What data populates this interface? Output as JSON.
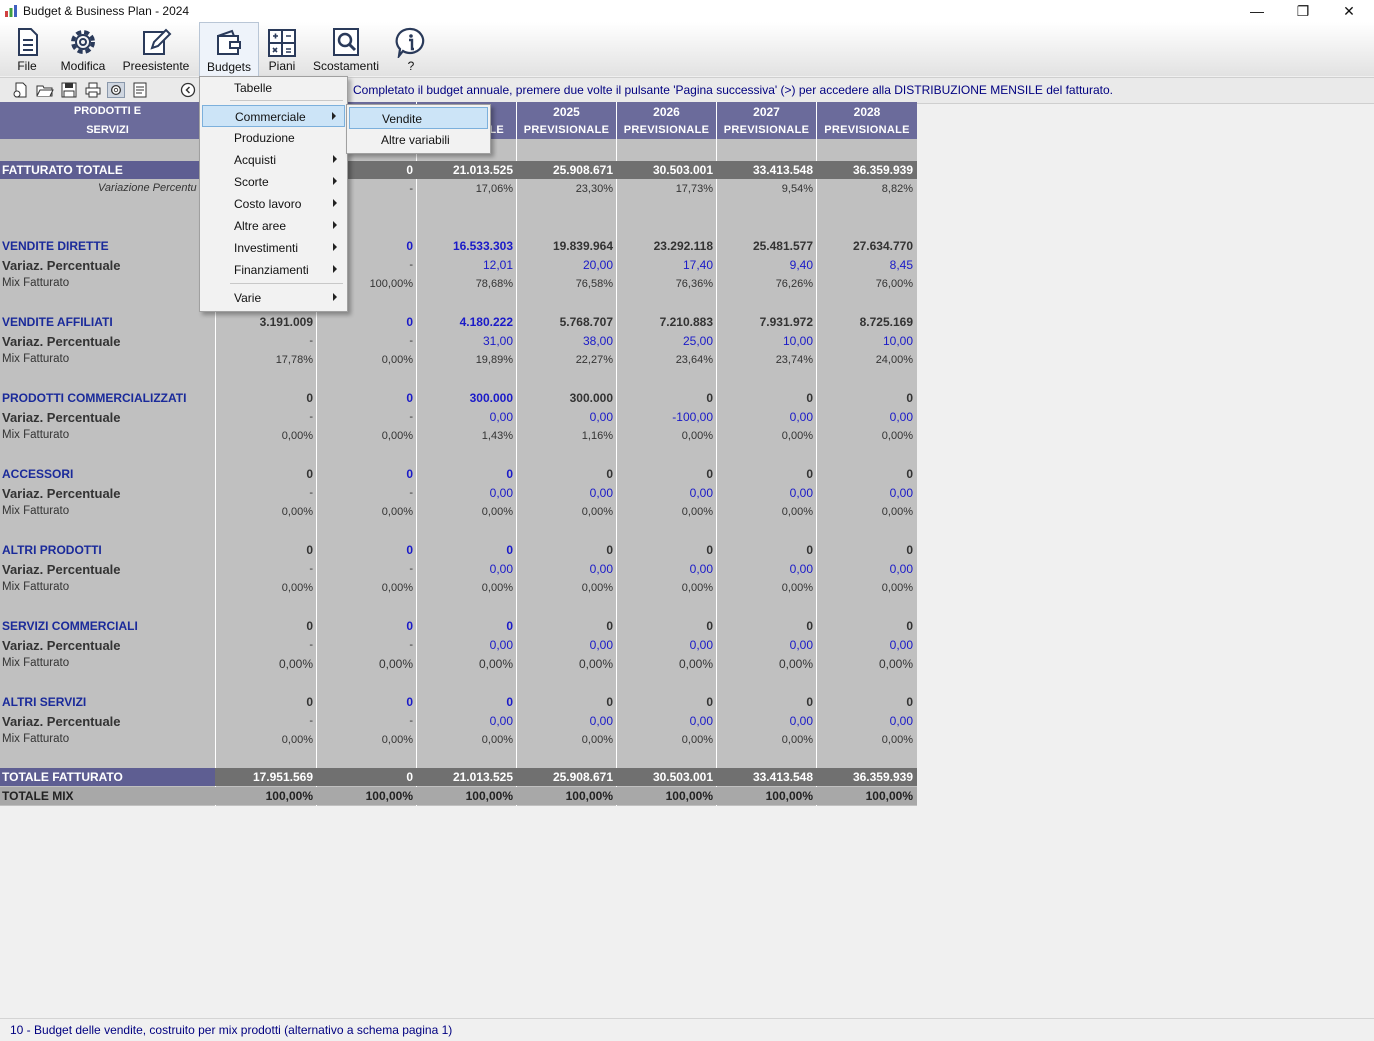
{
  "window": {
    "title": "Budget & Business Plan - 2024",
    "minimize": "—",
    "restore": "❐",
    "close": "✕"
  },
  "ribbon": {
    "buttons": [
      {
        "label": "File",
        "icon": "document-icon"
      },
      {
        "label": "Modifica",
        "icon": "gear-icon"
      },
      {
        "label": "Preesistente",
        "icon": "pencil-icon"
      },
      {
        "label": "Budgets",
        "icon": "wallet-icon"
      },
      {
        "label": "Piani",
        "icon": "calculator-icon"
      },
      {
        "label": "Scostamenti",
        "icon": "magnifier-icon"
      },
      {
        "label": "?",
        "icon": "info-icon"
      }
    ]
  },
  "toolbar": {
    "message": "Completato il budget annuale, premere due volte il pulsante 'Pagina successiva' (>) per accedere alla DISTRIBUZIONE MENSILE del fatturato."
  },
  "grid": {
    "header": {
      "label_line1": "PRODOTTI  E",
      "label_line2": "SERVIZI",
      "col3_line2": "LE",
      "years": [
        {
          "year": "2025",
          "sub": "PREVISIONALE"
        },
        {
          "year": "2026",
          "sub": "PREVISIONALE"
        },
        {
          "year": "2027",
          "sub": "PREVISIONALE"
        },
        {
          "year": "2028",
          "sub": "PREVISIONALE"
        }
      ]
    },
    "fatturato_totale": {
      "label": "FATTURATO TOTALE",
      "values": [
        "",
        "0",
        "21.013.525",
        "25.908.671",
        "30.503.001",
        "33.413.548",
        "36.359.939"
      ]
    },
    "variazione": {
      "label": "Variazione Percentu",
      "values": [
        "",
        "-",
        "17,06%",
        "23,30%",
        "17,73%",
        "9,54%",
        "8,82%"
      ]
    },
    "sections": [
      {
        "name": "VENDITE DIRETTE",
        "values": [
          "",
          "0",
          "16.533.303",
          "19.839.964",
          "23.292.118",
          "25.481.577",
          "27.634.770"
        ],
        "var_label": "Variaz. Percentuale",
        "var": [
          "",
          "-",
          "12,01",
          "20,00",
          "17,40",
          "9,40",
          "8,45"
        ],
        "mix_label": "Mix Fatturato",
        "mix": [
          "",
          "100,00%",
          "78,68%",
          "76,58%",
          "76,36%",
          "76,26%",
          "76,00%"
        ]
      },
      {
        "name": "VENDITE AFFILIATI",
        "values": [
          "3.191.009",
          "0",
          "4.180.222",
          "5.768.707",
          "7.210.883",
          "7.931.972",
          "8.725.169"
        ],
        "var_label": "Variaz. Percentuale",
        "var": [
          "-",
          "-",
          "31,00",
          "38,00",
          "25,00",
          "10,00",
          "10,00"
        ],
        "mix_label": "Mix Fatturato",
        "mix": [
          "17,78%",
          "0,00%",
          "19,89%",
          "22,27%",
          "23,64%",
          "23,74%",
          "24,00%"
        ]
      },
      {
        "name": "PRODOTTI COMMERCIALIZZATI",
        "values": [
          "0",
          "0",
          "300.000",
          "300.000",
          "0",
          "0",
          "0"
        ],
        "var_label": "Variaz. Percentuale",
        "var": [
          "-",
          "-",
          "0,00",
          "0,00",
          "-100,00",
          "0,00",
          "0,00"
        ],
        "mix_label": "Mix Fatturato",
        "mix": [
          "0,00%",
          "0,00%",
          "1,43%",
          "1,16%",
          "0,00%",
          "0,00%",
          "0,00%"
        ]
      },
      {
        "name": "ACCESSORI",
        "values": [
          "0",
          "0",
          "0",
          "0",
          "0",
          "0",
          "0"
        ],
        "var_label": "Variaz. Percentuale",
        "var": [
          "-",
          "-",
          "0,00",
          "0,00",
          "0,00",
          "0,00",
          "0,00"
        ],
        "mix_label": "Mix Fatturato",
        "mix": [
          "0,00%",
          "0,00%",
          "0,00%",
          "0,00%",
          "0,00%",
          "0,00%",
          "0,00%"
        ]
      },
      {
        "name": "ALTRI PRODOTTI",
        "values": [
          "0",
          "0",
          "0",
          "0",
          "0",
          "0",
          "0"
        ],
        "var_label": "Variaz. Percentuale",
        "var": [
          "-",
          "-",
          "0,00",
          "0,00",
          "0,00",
          "0,00",
          "0,00"
        ],
        "mix_label": "Mix Fatturato",
        "mix": [
          "0,00%",
          "0,00%",
          "0,00%",
          "0,00%",
          "0,00%",
          "0,00%",
          "0,00%"
        ]
      },
      {
        "name": "SERVIZI COMMERCIALI",
        "values": [
          "0",
          "0",
          "0",
          "0",
          "0",
          "0",
          "0"
        ],
        "var_label": "Variaz. Percentuale",
        "var": [
          "-",
          "-",
          "0,00",
          "0,00",
          "0,00",
          "0,00",
          "0,00"
        ],
        "mix_label": "Mix Fatturato",
        "mix": [
          "0,00%",
          "0,00%",
          "0,00%",
          "0,00%",
          "0,00%",
          "0,00%",
          "0,00%"
        ]
      },
      {
        "name": "ALTRI SERVIZI",
        "values": [
          "0",
          "0",
          "0",
          "0",
          "0",
          "0",
          "0"
        ],
        "var_label": "Variaz. Percentuale",
        "var": [
          "-",
          "-",
          "0,00",
          "0,00",
          "0,00",
          "0,00",
          "0,00"
        ],
        "mix_label": "Mix Fatturato",
        "mix": [
          "0,00%",
          "0,00%",
          "0,00%",
          "0,00%",
          "0,00%",
          "0,00%",
          "0,00%"
        ]
      }
    ],
    "totale_fatturato": {
      "label": "TOTALE FATTURATO",
      "values": [
        "17.951.569",
        "0",
        "21.013.525",
        "25.908.671",
        "30.503.001",
        "33.413.548",
        "36.359.939"
      ]
    },
    "totale_mix": {
      "label": "TOTALE MIX",
      "values": [
        "100,00%",
        "100,00%",
        "100,00%",
        "100,00%",
        "100,00%",
        "100,00%",
        "100,00%"
      ]
    }
  },
  "budgets_menu": {
    "items": [
      {
        "label": "Tabelle",
        "submenu": false
      },
      {
        "label": "Commerciale",
        "submenu": true,
        "highlighted": true
      },
      {
        "label": "Produzione",
        "submenu": false
      },
      {
        "label": "Acquisti",
        "submenu": true
      },
      {
        "label": "Scorte",
        "submenu": true
      },
      {
        "label": "Costo lavoro",
        "submenu": true
      },
      {
        "label": "Altre aree",
        "submenu": true
      },
      {
        "label": "Investimenti",
        "submenu": true
      },
      {
        "label": "Finanziamenti",
        "submenu": true
      },
      {
        "label": "Varie",
        "submenu": true
      }
    ]
  },
  "commerciale_submenu": {
    "items": [
      {
        "label": "Vendite",
        "highlighted": true
      },
      {
        "label": "Altre variabili"
      }
    ]
  },
  "statusbar": {
    "text": "10 - Budget delle vendite, costruito per mix prodotti (alternativo a schema pagina 1)"
  }
}
